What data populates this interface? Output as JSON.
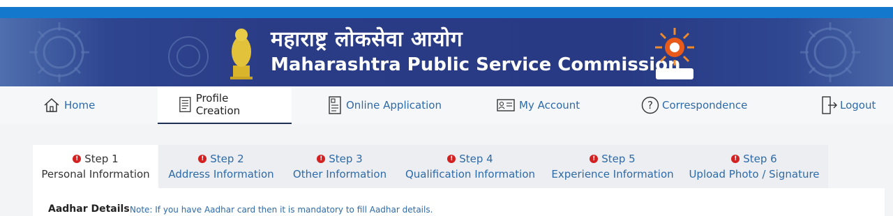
{
  "header": {
    "title_marathi": "महाराष्ट्र लोकसेवा आयोग",
    "title_english": "Maharashtra Public Service Commission"
  },
  "nav": {
    "items": [
      {
        "label": "Home",
        "icon": "home-icon"
      },
      {
        "label": "Profile Creation",
        "icon": "document-icon"
      },
      {
        "label": "Online Application",
        "icon": "form-icon"
      },
      {
        "label": "My Account",
        "icon": "id-card-icon"
      },
      {
        "label": "Correspondence",
        "icon": "question-icon"
      },
      {
        "label": "Logout",
        "icon": "logout-icon"
      }
    ],
    "active": "Profile Creation"
  },
  "steps": [
    {
      "step": "Step 1",
      "label": "Personal Information"
    },
    {
      "step": "Step 2",
      "label": "Address Information"
    },
    {
      "step": "Step 3",
      "label": "Other Information"
    },
    {
      "step": "Step 4",
      "label": "Qualification Information"
    },
    {
      "step": "Step 5",
      "label": "Experience Information"
    },
    {
      "step": "Step 6",
      "label": "Upload Photo / Signature"
    }
  ],
  "section": {
    "title": "Aadhar Details",
    "note": "Note: If you have Aadhar card then it is mandatory to fill Aadhar details."
  },
  "colors": {
    "banner": "#2b3c86",
    "top_bar": "#1479cc",
    "link": "#2d6aa8",
    "warning": "#d32020"
  }
}
